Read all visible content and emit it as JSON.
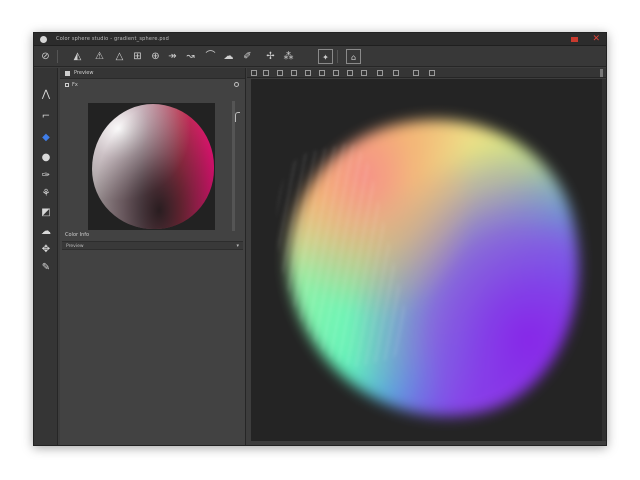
{
  "window": {
    "title": "Color sphere studio - gradient_sphere.psd"
  },
  "toolbar": {
    "icons": [
      "brush-icon",
      "triangle-icon",
      "warning-icon",
      "grid-icon",
      "globe-icon",
      "arrow-icon",
      "blend-icon",
      "curve-icon",
      "path-icon",
      "eyedrop-icon",
      "move-icon",
      "frame-icon",
      "frame-alt-icon"
    ]
  },
  "tools": {
    "icons": [
      "arrow-tool-icon",
      "lasso-tool-icon",
      "fill-tool-icon",
      "sphere-tool-icon",
      "brush-tool-icon",
      "wand-tool-icon",
      "eraser-tool-icon",
      "cloud-tool-icon",
      "hand-tool-icon",
      "pen-tool-icon"
    ]
  },
  "panel": {
    "header": "Preview",
    "sub": "Fx",
    "footer_label": "Color Info",
    "dropdown_text": "Preview"
  },
  "colors": {
    "accent": "#c93a2e",
    "window_bg": "#3d3d3d",
    "canvas_bg": "#242424"
  }
}
